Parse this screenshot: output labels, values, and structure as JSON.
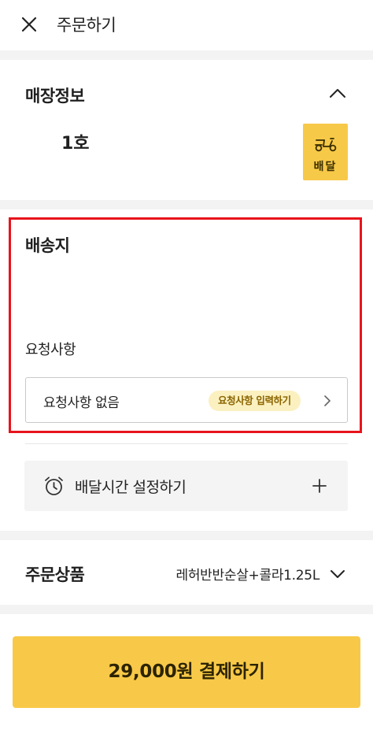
{
  "header": {
    "title": "주문하기"
  },
  "store": {
    "section_title": "매장정보",
    "store_name": "1호",
    "delivery_badge_label": "배달"
  },
  "address": {
    "section_title": "배송지",
    "request_title": "요청사항",
    "request_value": "요청사항 없음",
    "request_chip": "요청사항 입력하기"
  },
  "delivery_time": {
    "label": "배달시간 설정하기"
  },
  "products": {
    "section_title": "주문상품",
    "summary": "레허반반순살+콜라1.25L"
  },
  "payment": {
    "button_label": "29,000원 결제하기"
  },
  "colors": {
    "accent_yellow": "#f8c948",
    "highlight_red": "#e8131c",
    "chip_background": "#fbf0bf",
    "chip_text": "#8a6400"
  }
}
